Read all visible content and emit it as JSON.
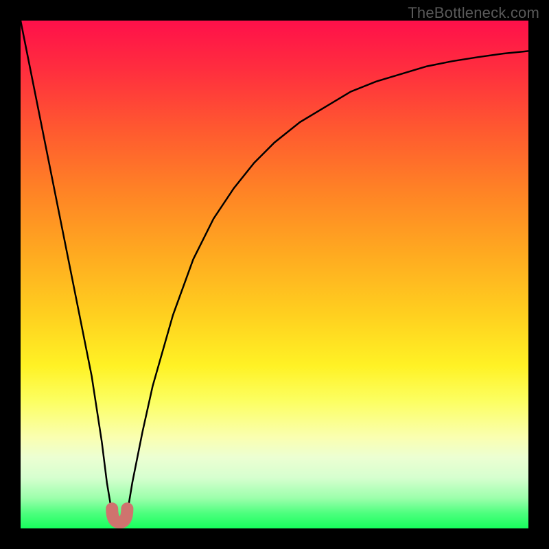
{
  "watermark": "TheBottleneck.com",
  "chart_data": {
    "type": "line",
    "title": "",
    "xlabel": "",
    "ylabel": "",
    "xlim": [
      0,
      100
    ],
    "ylim": [
      0,
      100
    ],
    "grid": false,
    "series": [
      {
        "name": "bottleneck-curve",
        "x": [
          0,
          2,
          4,
          6,
          8,
          10,
          12,
          14,
          16,
          17,
          18,
          19,
          20,
          21,
          22,
          24,
          26,
          28,
          30,
          34,
          38,
          42,
          46,
          50,
          55,
          60,
          65,
          70,
          75,
          80,
          85,
          90,
          95,
          100
        ],
        "y": [
          100,
          90,
          80,
          70,
          60,
          50,
          40,
          30,
          17,
          9,
          3,
          1,
          1,
          3,
          9,
          19,
          28,
          35,
          42,
          53,
          61,
          67,
          72,
          76,
          80,
          83,
          86,
          88,
          89.5,
          91,
          92,
          92.8,
          93.5,
          94
        ]
      }
    ],
    "marker": {
      "name": "optimal-range",
      "x": [
        18,
        21
      ],
      "y": [
        2,
        2
      ],
      "color": "#cf736e"
    },
    "background_gradient": {
      "top": "#ff104a",
      "mid": "#ffeb20",
      "bottom": "#17ff5d"
    }
  }
}
